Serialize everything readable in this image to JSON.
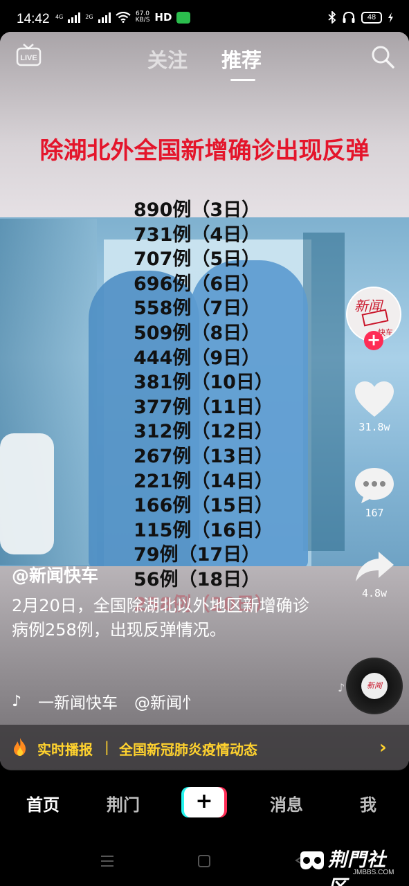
{
  "status_bar": {
    "time": "14:42",
    "signal1": "4G",
    "signal2": "2G",
    "speed_value": "67.0",
    "speed_unit": "KB/S",
    "hd": "HD",
    "battery": "48"
  },
  "top_nav": {
    "live_icon": "live-icon",
    "tabs": [
      {
        "label": "关注",
        "active": false
      },
      {
        "label": "推荐",
        "active": true
      }
    ],
    "search_icon": "search-icon"
  },
  "video": {
    "headline": "除湖北外全国新增确诊出现反弹",
    "cases": [
      "890例（3日）",
      "731例（4日）",
      "707例（5日）",
      "696例（6日）",
      "558例（7日）",
      "509例（8日）",
      "444例（9日）",
      "381例（10日）",
      "377例（11日）",
      "312例（12日）",
      "267例（13日）",
      "221例（14日）",
      "166例（15日）",
      "115例（16日）",
      "79例（17日）",
      "56例（18日）",
      "258例（20日）"
    ]
  },
  "actions": {
    "avatar": {
      "seal": "新闻",
      "small": "快车"
    },
    "follow": "+",
    "like_count": "31.8w",
    "comment_count": "167",
    "share_count": "4.8w",
    "disc_label": "新闻"
  },
  "caption": {
    "author": "@新闻快车",
    "description": "2月20日，全国除湖北以外地区新增确诊病例258例，出现反弹情况。",
    "music_icon": "douyin-note-icon",
    "music_source": "一新闻快车",
    "music_author": "@新闻忄"
  },
  "banner": {
    "label": "实时播报",
    "separator": "|",
    "topic": "全国新冠肺炎疫情动态",
    "chevron": "›"
  },
  "bottom_nav": {
    "items": [
      {
        "label": "首页",
        "active": true
      },
      {
        "label": "荆门",
        "active": false
      },
      {
        "label": "消息",
        "active": false
      },
      {
        "label": "我",
        "active": false
      }
    ],
    "create_label": "+"
  },
  "watermark": {
    "title": "荆門社区",
    "sub": "JMBBS.COM"
  },
  "colors": {
    "headline_red": "#e4152b",
    "banner_yellow": "#ffd22e",
    "follow_pink": "#fe2c55",
    "create_cyan": "#25f4ee"
  }
}
